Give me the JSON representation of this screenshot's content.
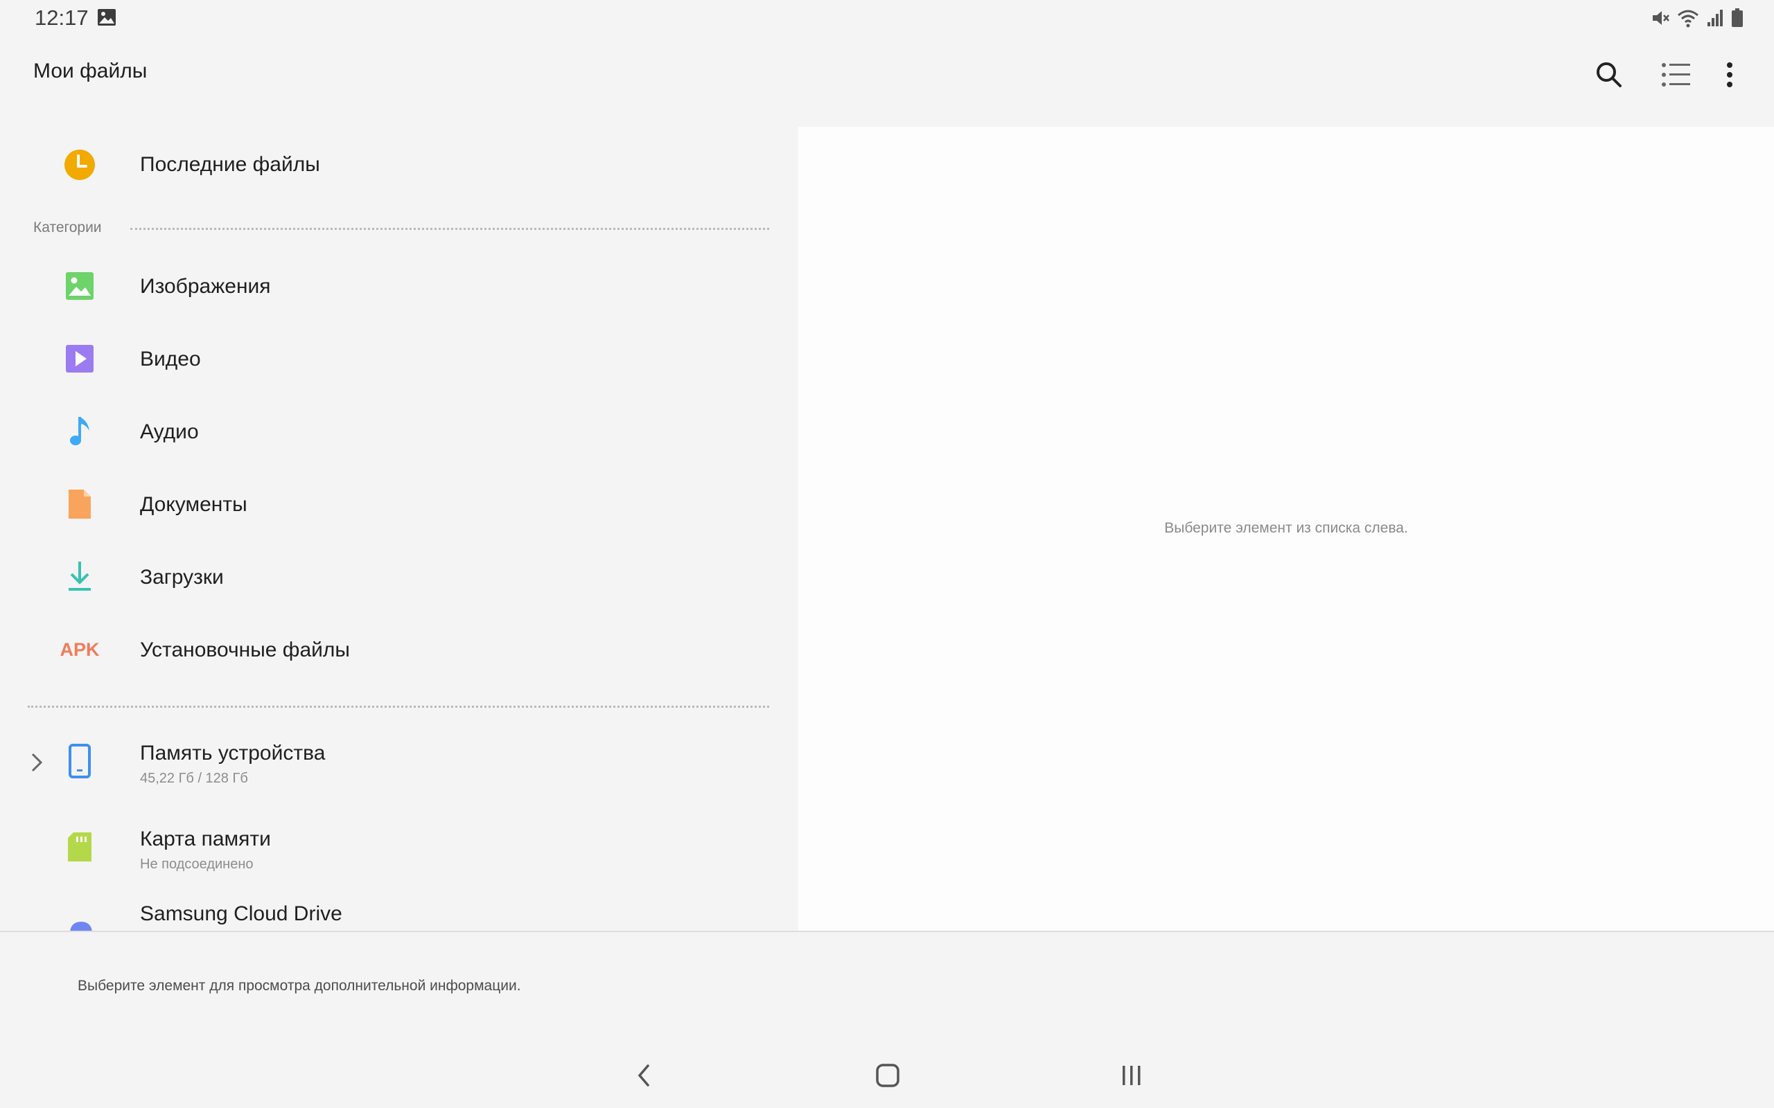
{
  "status_bar": {
    "time": "12:17",
    "icons": [
      "gallery-notification-icon",
      "mute-icon",
      "wifi-icon",
      "signal-icon",
      "battery-icon"
    ]
  },
  "app_bar": {
    "title": "Мои файлы",
    "actions": [
      "search-icon",
      "list-view-icon",
      "more-options-icon"
    ]
  },
  "recent": {
    "label": "Последние файлы",
    "icon": "clock-icon",
    "color": "#f2a900"
  },
  "categories": {
    "header": "Категории",
    "items": [
      {
        "label": "Изображения",
        "icon": "image-icon",
        "color": "#6dd36a"
      },
      {
        "label": "Видео",
        "icon": "video-icon",
        "color": "#9b7cf0"
      },
      {
        "label": "Аудио",
        "icon": "music-note-icon",
        "color": "#3fa9f5"
      },
      {
        "label": "Документы",
        "icon": "document-icon",
        "color": "#f9a45c"
      },
      {
        "label": "Загрузки",
        "icon": "download-icon",
        "color": "#36c2b4"
      },
      {
        "label": "Установочные файлы",
        "icon": "apk-icon",
        "icon_text": "APK",
        "color": "#f07c5c"
      }
    ]
  },
  "storage": {
    "items": [
      {
        "label": "Память устройства",
        "sublabel": "45,22 Гб / 128 Гб",
        "icon": "phone-icon",
        "color": "#3f8ff0"
      },
      {
        "label": "Карта памяти",
        "sublabel": "Не подсоединено",
        "icon": "sd-card-icon",
        "color": "#b3d84a"
      },
      {
        "label": "Samsung Cloud Drive",
        "icon": "cloud-icon",
        "color": "#6f86f2"
      }
    ]
  },
  "detail": {
    "empty_message": "Выберите элемент из списка слева."
  },
  "bottom": {
    "info": "Выберите элемент для просмотра дополнительной информации."
  },
  "navigation": [
    "back-icon",
    "home-icon",
    "recents-icon"
  ]
}
